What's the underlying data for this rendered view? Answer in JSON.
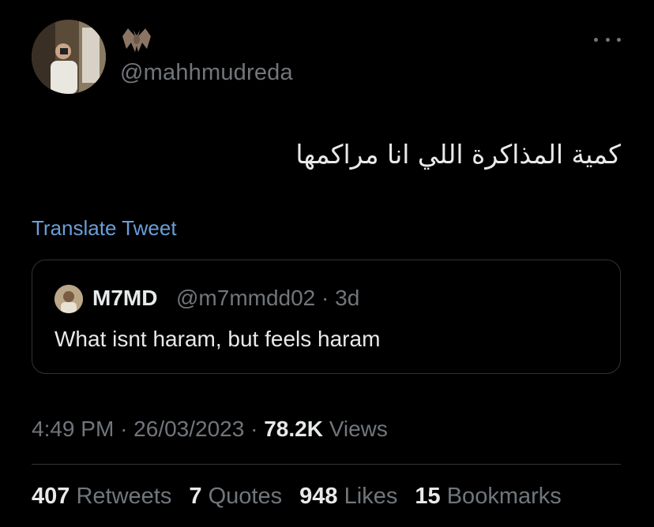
{
  "author": {
    "handle": "@mahhmudreda",
    "name_emoji_icon": "bat-icon"
  },
  "tweet": {
    "text": "كمية المذاكرة اللي انا مراكمها",
    "translate_label": "Translate Tweet"
  },
  "quoted": {
    "name": "M7MD",
    "handle": "@m7mmdd02",
    "separator": "·",
    "age": "3d",
    "text": "What isnt haram, but feels haram"
  },
  "meta": {
    "time": "4:49 PM",
    "sep1": "·",
    "date": "26/03/2023",
    "sep2": "·",
    "views_count": "78.2K",
    "views_label": "Views"
  },
  "stats": {
    "retweets_count": "407",
    "retweets_label": "Retweets",
    "quotes_count": "7",
    "quotes_label": "Quotes",
    "likes_count": "948",
    "likes_label": "Likes",
    "bookmarks_count": "15",
    "bookmarks_label": "Bookmarks"
  },
  "colors": {
    "background": "#000000",
    "text": "#e7e9ea",
    "secondary": "#71767b",
    "link": "#6a9ed8",
    "border": "#2f3336"
  }
}
